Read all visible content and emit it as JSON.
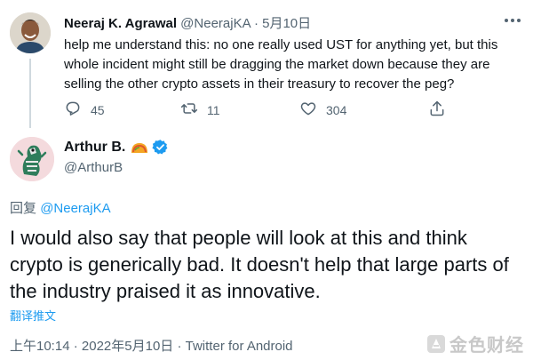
{
  "parent_tweet": {
    "name": "Neeraj K. Agrawal",
    "handle": "@NeerajKA",
    "dot": "·",
    "date": "5月10日",
    "text": "help me understand this: no one really used UST for anything yet, but this whole incident might still be dragging the market down because they are selling the other crypto assets in their treasury to recover the peg?",
    "actions": {
      "reply_count": "45",
      "retweet_count": "11",
      "like_count": "304"
    }
  },
  "main_tweet": {
    "name": "Arthur B.",
    "handle": "@ArthurB",
    "reply_prefix": "回复",
    "reply_mention": "@NeerajKA",
    "text": "I would also say that people will look at this and think crypto is generically bad. It doesn't help that large parts of the industry praised it as innovative.",
    "translate_label": "翻译推文",
    "time": "上午10:14",
    "dot": "·",
    "date": "2022年5月10日",
    "source": "Twitter for Android"
  },
  "watermark": {
    "text": "金色财经"
  },
  "colors": {
    "accent": "#1d9bf0",
    "secondary_text": "#536471",
    "primary_text": "#0f1419",
    "thread_line": "#cfd9de"
  },
  "icons": {
    "more": "more-horizontal-icon",
    "reply": "reply-icon",
    "retweet": "retweet-icon",
    "like": "heart-icon",
    "share": "share-icon",
    "verified": "verified-badge-icon",
    "emoji": "taco-emoji-icon",
    "watermark_logo": "jinse-logo-icon"
  }
}
